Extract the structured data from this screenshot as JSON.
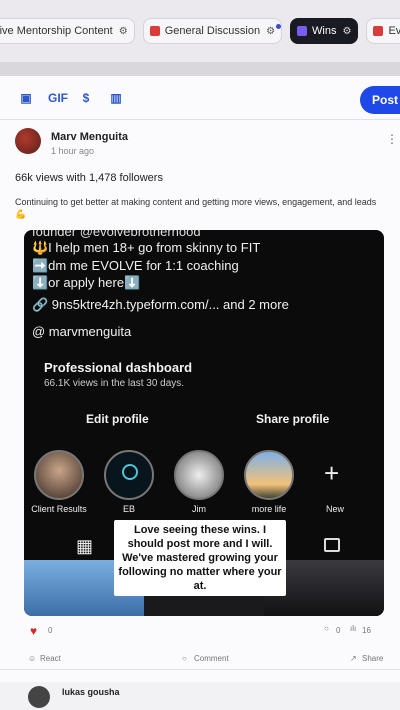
{
  "tabs": [
    {
      "label": "usive Mentorship Content",
      "color": "",
      "active": false
    },
    {
      "label": "General Discussion",
      "color": "#d93a3a",
      "active": false
    },
    {
      "label": "Wins",
      "color": "#7a5cf0",
      "active": true
    },
    {
      "label": "Ever",
      "color": "#d93a3a",
      "active": false
    }
  ],
  "composer": {
    "tools": [
      "image-icon",
      "GIF",
      "$",
      "poll-icon"
    ],
    "gif_label": "GIF",
    "money_label": "$",
    "post_label": "Post"
  },
  "post": {
    "author": "Marv Menguita",
    "time": "1 hour ago",
    "headline": "66k views with 1,478 followers",
    "body": "Continuing to get better at making content and getting more views, engagement, and leads💪"
  },
  "screenshot": {
    "bio_top": "founder @evolvebrotherhood",
    "bio_line1": "🔱I help men 18+ go from skinny to FIT",
    "bio_line2": "➡️dm me EVOLVE for 1:1 coaching",
    "bio_line3": "⬇️or apply here⬇️",
    "link": "🔗 9ns5ktre4zh.typeform.com/...  and 2 more",
    "threads": "@ marvmenguita",
    "dash_title": "Professional dashboard",
    "dash_sub": "66.1K views in the last 30 days.",
    "edit_profile": "Edit profile",
    "share_profile": "Share profile",
    "highlights": [
      "Client Results",
      "EB",
      "Jim",
      "more life"
    ],
    "new_label": "New",
    "overlay": "Love seeing these wins. I should post more and I will. We've mastered growing your following no matter where your at."
  },
  "reactions": {
    "likes": "0",
    "comments": "0",
    "views": "16"
  },
  "actions": {
    "react": "React",
    "comment": "Comment",
    "share": "Share"
  },
  "next_post": {
    "author": "lukas gousha"
  }
}
